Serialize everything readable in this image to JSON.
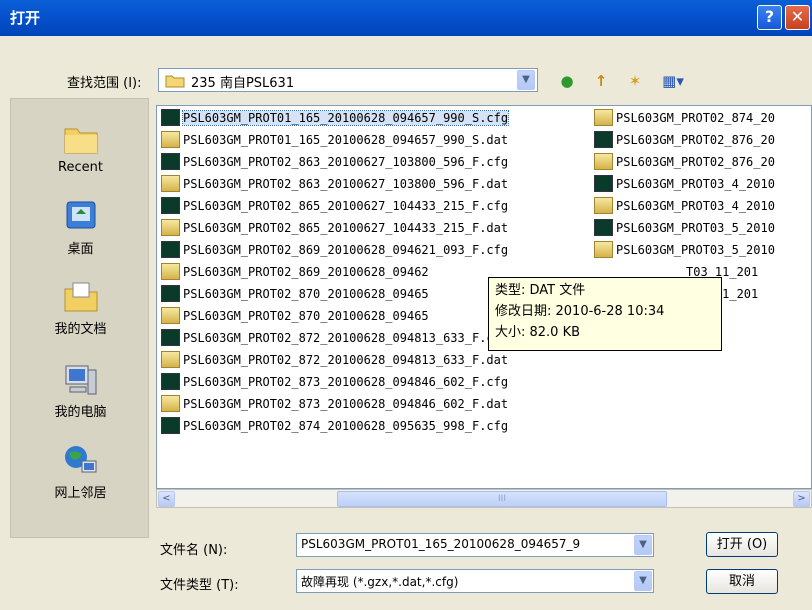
{
  "window": {
    "title": "打开",
    "help_glyph": "?",
    "close_glyph": "✕"
  },
  "look_in": {
    "label": "查找范围 (I):",
    "value": "235 南自PSL631"
  },
  "toolbar": {
    "back_glyph": "●",
    "up_glyph": "↑",
    "new_folder_glyph": "✶",
    "view_glyph": "▦▾"
  },
  "places": [
    {
      "label": "Recent",
      "icon": "recent-folder-icon"
    },
    {
      "label": "桌面",
      "icon": "desktop-icon"
    },
    {
      "label": "我的文档",
      "icon": "documents-icon"
    },
    {
      "label": "我的电脑",
      "icon": "computer-icon"
    },
    {
      "label": "网上邻居",
      "icon": "network-icon"
    }
  ],
  "files_col1": [
    {
      "name": "PSL603GM_PROT01_165_20100628_094657_990_S.cfg",
      "type": "cfg"
    },
    {
      "name": "PSL603GM_PROT01_165_20100628_094657_990_S.dat",
      "type": "dat"
    },
    {
      "name": "PSL603GM_PROT02_863_20100627_103800_596_F.cfg",
      "type": "cfg"
    },
    {
      "name": "PSL603GM_PROT02_863_20100627_103800_596_F.dat",
      "type": "dat"
    },
    {
      "name": "PSL603GM_PROT02_865_20100627_104433_215_F.cfg",
      "type": "cfg"
    },
    {
      "name": "PSL603GM_PROT02_865_20100627_104433_215_F.dat",
      "type": "dat"
    },
    {
      "name": "PSL603GM_PROT02_869_20100628_094621_093_F.cfg",
      "type": "cfg"
    },
    {
      "name": "PSL603GM_PROT02_869_20100628_09462",
      "type": "dat"
    },
    {
      "name": "PSL603GM_PROT02_870_20100628_09465",
      "type": "cfg"
    },
    {
      "name": "PSL603GM_PROT02_870_20100628_09465",
      "type": "dat"
    },
    {
      "name": "PSL603GM_PROT02_872_20100628_094813_633_F.cfg",
      "type": "cfg"
    },
    {
      "name": "PSL603GM_PROT02_872_20100628_094813_633_F.dat",
      "type": "dat"
    },
    {
      "name": "PSL603GM_PROT02_873_20100628_094846_602_F.cfg",
      "type": "cfg"
    },
    {
      "name": "PSL603GM_PROT02_873_20100628_094846_602_F.dat",
      "type": "dat"
    },
    {
      "name": "PSL603GM_PROT02_874_20100628_095635_998_F.cfg",
      "type": "cfg"
    }
  ],
  "files_col2": [
    {
      "name": "PSL603GM_PROT02_874_20",
      "type": "dat"
    },
    {
      "name": "PSL603GM_PROT02_876_20",
      "type": "cfg"
    },
    {
      "name": "PSL603GM_PROT02_876_20",
      "type": "dat"
    },
    {
      "name": "PSL603GM_PROT03_4_2010",
      "type": "cfg"
    },
    {
      "name": "PSL603GM_PROT03_4_2010",
      "type": "dat"
    },
    {
      "name": "PSL603GM_PROT03_5_2010",
      "type": "cfg"
    },
    {
      "name": "PSL603GM_PROT03_5_2010",
      "type": "dat"
    },
    {
      "name": "T03_11_201",
      "type": "none"
    },
    {
      "name": "T03_11_201",
      "type": "none"
    }
  ],
  "tooltip": {
    "type_line": "类型: DAT 文件",
    "modified_line": "修改日期: 2010-6-28 10:34",
    "size_line": "大小: 82.0 KB"
  },
  "filename": {
    "label": "文件名 (N):",
    "value": "PSL603GM_PROT01_165_20100628_094657_9"
  },
  "filetype": {
    "label": "文件类型 (T):",
    "value": "故障再现 (*.gzx,*.dat,*.cfg)"
  },
  "buttons": {
    "open": "打开 (O)",
    "cancel": "取消"
  },
  "scroll": {
    "left_glyph": "<",
    "right_glyph": ">",
    "grip": "III"
  },
  "colors": {
    "title_blue": "#0653cf",
    "selection": "#316ac5",
    "tooltip_bg": "#ffffe1"
  }
}
